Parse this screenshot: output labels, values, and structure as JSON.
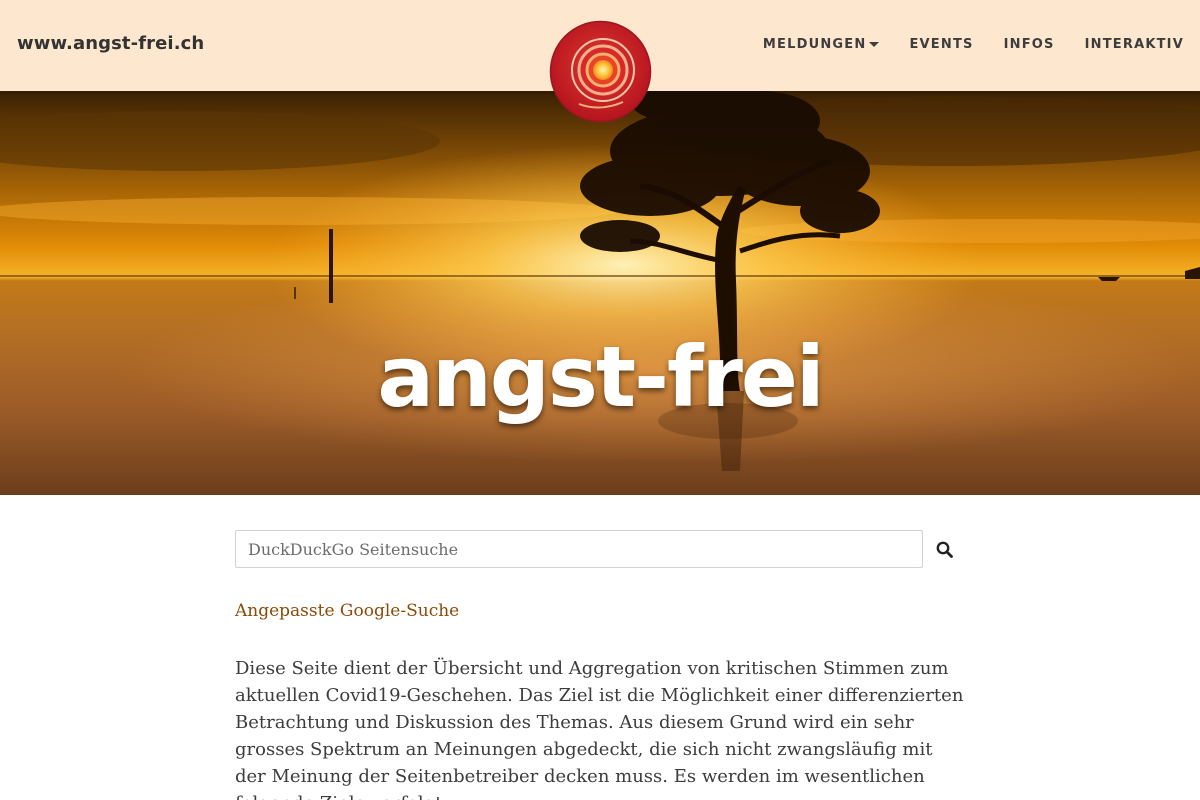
{
  "site": {
    "brand": "www.angst-frei.ch"
  },
  "nav": {
    "items": [
      {
        "label": "MELDUNGEN",
        "dropdown": true
      },
      {
        "label": "EVENTS"
      },
      {
        "label": "INFOS"
      },
      {
        "label": "INTERAKTIV"
      }
    ]
  },
  "hero": {
    "title": "angst-frei"
  },
  "search": {
    "placeholder": "DuckDuckGo Seitensuche",
    "button_icon": "search-icon"
  },
  "google_link": "Angepasste Google-Suche",
  "intro": "Diese Seite dient der Übersicht und Aggregation von kritischen Stimmen zum aktuellen Covid19-Geschehen. Das Ziel ist die Möglichkeit einer differenzierten Betrachtung und Diskussion des Themas. Aus diesem Grund wird ein sehr grosses Spektrum an Meinungen abgedeckt, die sich nicht zwangsläufig mit der Meinung der Seitenbetreiber decken muss. Es werden im wesentlichen folgende Ziele verfolgt:",
  "colors": {
    "navbar_bg": "#fde7cf",
    "link": "#8a4b08",
    "logo_red": "#c8202a"
  }
}
